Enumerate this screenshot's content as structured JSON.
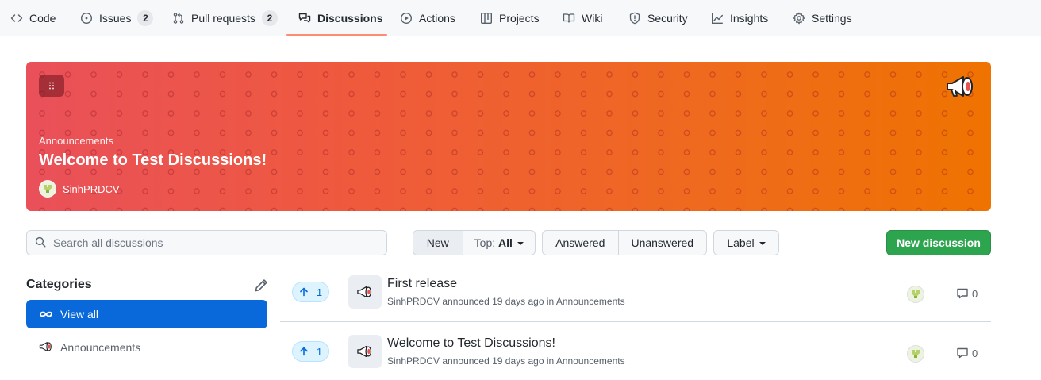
{
  "repo_nav": {
    "items": [
      {
        "label": "Code",
        "icon": "code-icon"
      },
      {
        "label": "Issues",
        "icon": "issue-opened-icon",
        "count": "2"
      },
      {
        "label": "Pull requests",
        "icon": "git-pull-request-icon",
        "count": "2"
      },
      {
        "label": "Discussions",
        "icon": "comment-discussion-icon",
        "active": true
      },
      {
        "label": "Actions",
        "icon": "play-icon"
      },
      {
        "label": "Projects",
        "icon": "table-icon"
      },
      {
        "label": "Wiki",
        "icon": "book-icon"
      },
      {
        "label": "Security",
        "icon": "shield-icon"
      },
      {
        "label": "Insights",
        "icon": "graph-icon"
      },
      {
        "label": "Settings",
        "icon": "gear-icon"
      }
    ],
    "active_underline_color": "#fd8c73"
  },
  "hero": {
    "category": "Announcements",
    "title": "Welcome to Test Discussions!",
    "author": "SinhPRDCV",
    "gradient": [
      "#e9505a",
      "#ef7300"
    ],
    "emoji": "loudspeaker-icon"
  },
  "toolbar": {
    "search_placeholder": "Search all discussions",
    "sort_new": "New",
    "sort_top_prefix": "Top:",
    "sort_top_value": "All",
    "filter_answered": "Answered",
    "filter_unanswered": "Unanswered",
    "label_filter": "Label",
    "new_discussion": "New discussion"
  },
  "sidebar": {
    "heading": "Categories",
    "items": [
      {
        "label": "View all",
        "icon": "infinity-icon",
        "active": true
      },
      {
        "label": "Announcements",
        "icon": "loudspeaker-icon",
        "active": false
      }
    ]
  },
  "discussions": [
    {
      "title": "First release",
      "author": "SinhPRDCV",
      "verb": "announced",
      "time": "19 days ago",
      "in_word": "in",
      "category": "Announcements",
      "votes": "1",
      "comments": "0"
    },
    {
      "title": "Welcome to Test Discussions!",
      "author": "SinhPRDCV",
      "verb": "announced",
      "time": "19 days ago",
      "in_word": "in",
      "category": "Announcements",
      "votes": "1",
      "comments": "0"
    }
  ],
  "colors": {
    "primary_blue": "#0969da",
    "new_button_green": "#2da44e",
    "vote_bg": "#ddf4ff"
  }
}
